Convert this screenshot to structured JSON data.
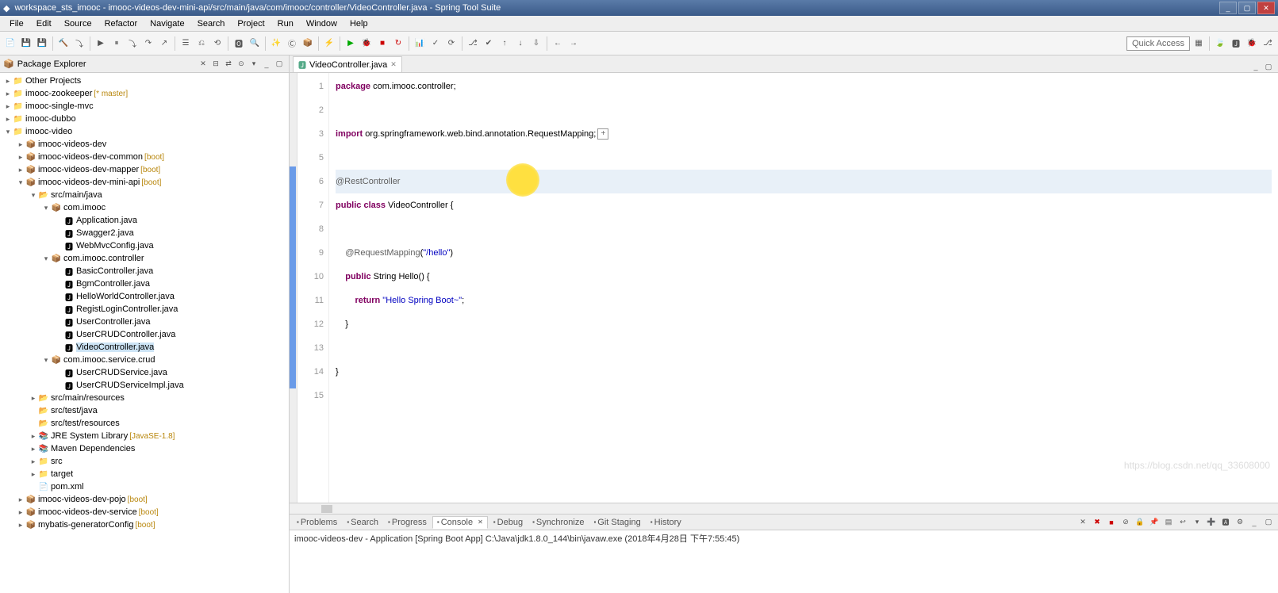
{
  "window": {
    "title": "workspace_sts_imooc - imooc-videos-dev-mini-api/src/main/java/com/imooc/controller/VideoController.java - Spring Tool Suite"
  },
  "menu": [
    "File",
    "Edit",
    "Source",
    "Refactor",
    "Navigate",
    "Search",
    "Project",
    "Run",
    "Window",
    "Help"
  ],
  "quickAccess": "Quick Access",
  "explorer": {
    "title": "Package Explorer"
  },
  "tree": [
    {
      "indent": 0,
      "exp": "▸",
      "icon": "📁",
      "label": "Other Projects",
      "decor": ""
    },
    {
      "indent": 0,
      "exp": "▸",
      "icon": "📁",
      "label": "imooc-zookeeper",
      "decor": "[* master]"
    },
    {
      "indent": 0,
      "exp": "▸",
      "icon": "📁",
      "label": "imooc-single-mvc",
      "decor": ""
    },
    {
      "indent": 0,
      "exp": "▸",
      "icon": "📁",
      "label": "imooc-dubbo",
      "decor": ""
    },
    {
      "indent": 0,
      "exp": "▾",
      "icon": "📁",
      "label": "imooc-video",
      "decor": ""
    },
    {
      "indent": 1,
      "exp": "▸",
      "icon": "📦",
      "label": "imooc-videos-dev",
      "decor": ""
    },
    {
      "indent": 1,
      "exp": "▸",
      "icon": "📦",
      "label": "imooc-videos-dev-common",
      "decor": "[boot]"
    },
    {
      "indent": 1,
      "exp": "▸",
      "icon": "📦",
      "label": "imooc-videos-dev-mapper",
      "decor": "[boot]"
    },
    {
      "indent": 1,
      "exp": "▾",
      "icon": "📦",
      "label": "imooc-videos-dev-mini-api",
      "decor": "[boot]"
    },
    {
      "indent": 2,
      "exp": "▾",
      "icon": "📂",
      "label": "src/main/java",
      "decor": ""
    },
    {
      "indent": 3,
      "exp": "▾",
      "icon": "📦",
      "label": "com.imooc",
      "decor": ""
    },
    {
      "indent": 4,
      "exp": "",
      "icon": "🅹",
      "label": "Application.java",
      "decor": ""
    },
    {
      "indent": 4,
      "exp": "",
      "icon": "🅹",
      "label": "Swagger2.java",
      "decor": ""
    },
    {
      "indent": 4,
      "exp": "",
      "icon": "🅹",
      "label": "WebMvcConfig.java",
      "decor": ""
    },
    {
      "indent": 3,
      "exp": "▾",
      "icon": "📦",
      "label": "com.imooc.controller",
      "decor": ""
    },
    {
      "indent": 4,
      "exp": "",
      "icon": "🅹",
      "label": "BasicController.java",
      "decor": ""
    },
    {
      "indent": 4,
      "exp": "",
      "icon": "🅹",
      "label": "BgmController.java",
      "decor": ""
    },
    {
      "indent": 4,
      "exp": "",
      "icon": "🅹",
      "label": "HelloWorldController.java",
      "decor": ""
    },
    {
      "indent": 4,
      "exp": "",
      "icon": "🅹",
      "label": "RegistLoginController.java",
      "decor": ""
    },
    {
      "indent": 4,
      "exp": "",
      "icon": "🅹",
      "label": "UserController.java",
      "decor": ""
    },
    {
      "indent": 4,
      "exp": "",
      "icon": "🅹",
      "label": "UserCRUDController.java",
      "decor": ""
    },
    {
      "indent": 4,
      "exp": "",
      "icon": "🅹",
      "label": "VideoController.java",
      "decor": "",
      "selected": true
    },
    {
      "indent": 3,
      "exp": "▾",
      "icon": "📦",
      "label": "com.imooc.service.crud",
      "decor": ""
    },
    {
      "indent": 4,
      "exp": "",
      "icon": "🅹",
      "label": "UserCRUDService.java",
      "decor": ""
    },
    {
      "indent": 4,
      "exp": "",
      "icon": "🅹",
      "label": "UserCRUDServiceImpl.java",
      "decor": ""
    },
    {
      "indent": 2,
      "exp": "▸",
      "icon": "📂",
      "label": "src/main/resources",
      "decor": ""
    },
    {
      "indent": 2,
      "exp": "",
      "icon": "📂",
      "label": "src/test/java",
      "decor": ""
    },
    {
      "indent": 2,
      "exp": "",
      "icon": "📂",
      "label": "src/test/resources",
      "decor": ""
    },
    {
      "indent": 2,
      "exp": "▸",
      "icon": "📚",
      "label": "JRE System Library",
      "decor": "[JavaSE-1.8]"
    },
    {
      "indent": 2,
      "exp": "▸",
      "icon": "📚",
      "label": "Maven Dependencies",
      "decor": ""
    },
    {
      "indent": 2,
      "exp": "▸",
      "icon": "📁",
      "label": "src",
      "decor": ""
    },
    {
      "indent": 2,
      "exp": "▸",
      "icon": "📁",
      "label": "target",
      "decor": ""
    },
    {
      "indent": 2,
      "exp": "",
      "icon": "📄",
      "label": "pom.xml",
      "decor": ""
    },
    {
      "indent": 1,
      "exp": "▸",
      "icon": "📦",
      "label": "imooc-videos-dev-pojo",
      "decor": "[boot]"
    },
    {
      "indent": 1,
      "exp": "▸",
      "icon": "📦",
      "label": "imooc-videos-dev-service",
      "decor": "[boot]"
    },
    {
      "indent": 1,
      "exp": "▸",
      "icon": "📦",
      "label": "mybatis-generatorConfig",
      "decor": "[boot]"
    }
  ],
  "editor": {
    "tab": "VideoController.java",
    "lines": [
      {
        "n": "1",
        "html": "<span class='kw'>package</span> com.imooc.controller;"
      },
      {
        "n": "2",
        "html": ""
      },
      {
        "n": "3",
        "html": "<span class='imp'>import</span> org.springframework.web.bind.annotation.RequestMapping;<span class='collapse-box'>+</span>",
        "marker": "•"
      },
      {
        "n": "5",
        "html": ""
      },
      {
        "n": "6",
        "html": "<span class='ann'>@RestController</span>",
        "current": true,
        "highlight": true
      },
      {
        "n": "7",
        "html": "<span class='kw'>public</span> <span class='kw'>class</span> VideoController {"
      },
      {
        "n": "8",
        "html": ""
      },
      {
        "n": "9",
        "html": "    <span class='ann'>@RequestMapping</span>(<span class='str'>\"/hello\"</span>)",
        "marker": "•"
      },
      {
        "n": "10",
        "html": "    <span class='kw'>public</span> String Hello() {"
      },
      {
        "n": "11",
        "html": "        <span class='kw'>return</span> <span class='str'>\"Hello Spring Boot~\"</span>;"
      },
      {
        "n": "12",
        "html": "    }"
      },
      {
        "n": "13",
        "html": ""
      },
      {
        "n": "14",
        "html": "}"
      },
      {
        "n": "15",
        "html": ""
      }
    ]
  },
  "bottomTabs": [
    "Problems",
    "Search",
    "Progress",
    "Console",
    "Debug",
    "Synchronize",
    "Git Staging",
    "History"
  ],
  "console": {
    "title": "imooc-videos-dev - Application [Spring Boot App] C:\\Java\\jdk1.8.0_144\\bin\\javaw.exe (2018年4月28日 下午7:55:45)"
  },
  "watermark": "https://blog.csdn.net/qq_33608000"
}
